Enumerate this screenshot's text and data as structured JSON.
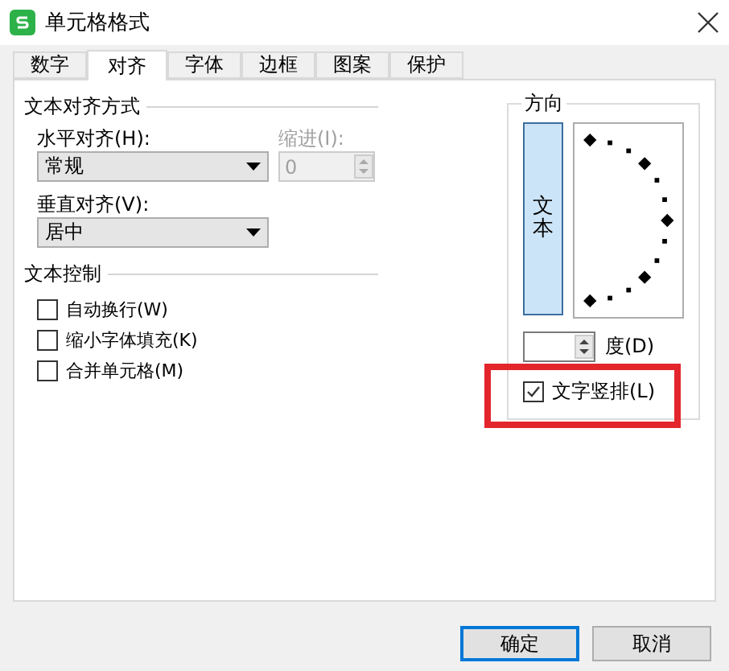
{
  "window": {
    "title": "单元格格式"
  },
  "tabs": [
    {
      "label": "数字",
      "selected": false
    },
    {
      "label": "对齐",
      "selected": true
    },
    {
      "label": "字体",
      "selected": false
    },
    {
      "label": "边框",
      "selected": false
    },
    {
      "label": "图案",
      "selected": false
    },
    {
      "label": "保护",
      "selected": false
    }
  ],
  "alignment": {
    "title": "文本对齐方式",
    "horizontal": {
      "label": "水平对齐(H):",
      "value": "常规"
    },
    "indent": {
      "label": "缩进(I):",
      "value": "0",
      "disabled": true
    },
    "vertical": {
      "label": "垂直对齐(V):",
      "value": "居中"
    }
  },
  "text_control": {
    "title": "文本控制",
    "options": [
      {
        "label": "自动换行(W)",
        "checked": false
      },
      {
        "label": "缩小字体填充(K)",
        "checked": false
      },
      {
        "label": "合并单元格(M)",
        "checked": false
      }
    ]
  },
  "orientation": {
    "title": "方向",
    "vertical_text_button": {
      "label": "文本",
      "selected": true
    },
    "degree_label": "度(D)",
    "stacked": {
      "label": "文字竖排(L)",
      "checked": true,
      "highlighted": true
    }
  },
  "buttons": [
    {
      "label": "确定",
      "default": true
    },
    {
      "label": "取消",
      "default": false
    }
  ]
}
